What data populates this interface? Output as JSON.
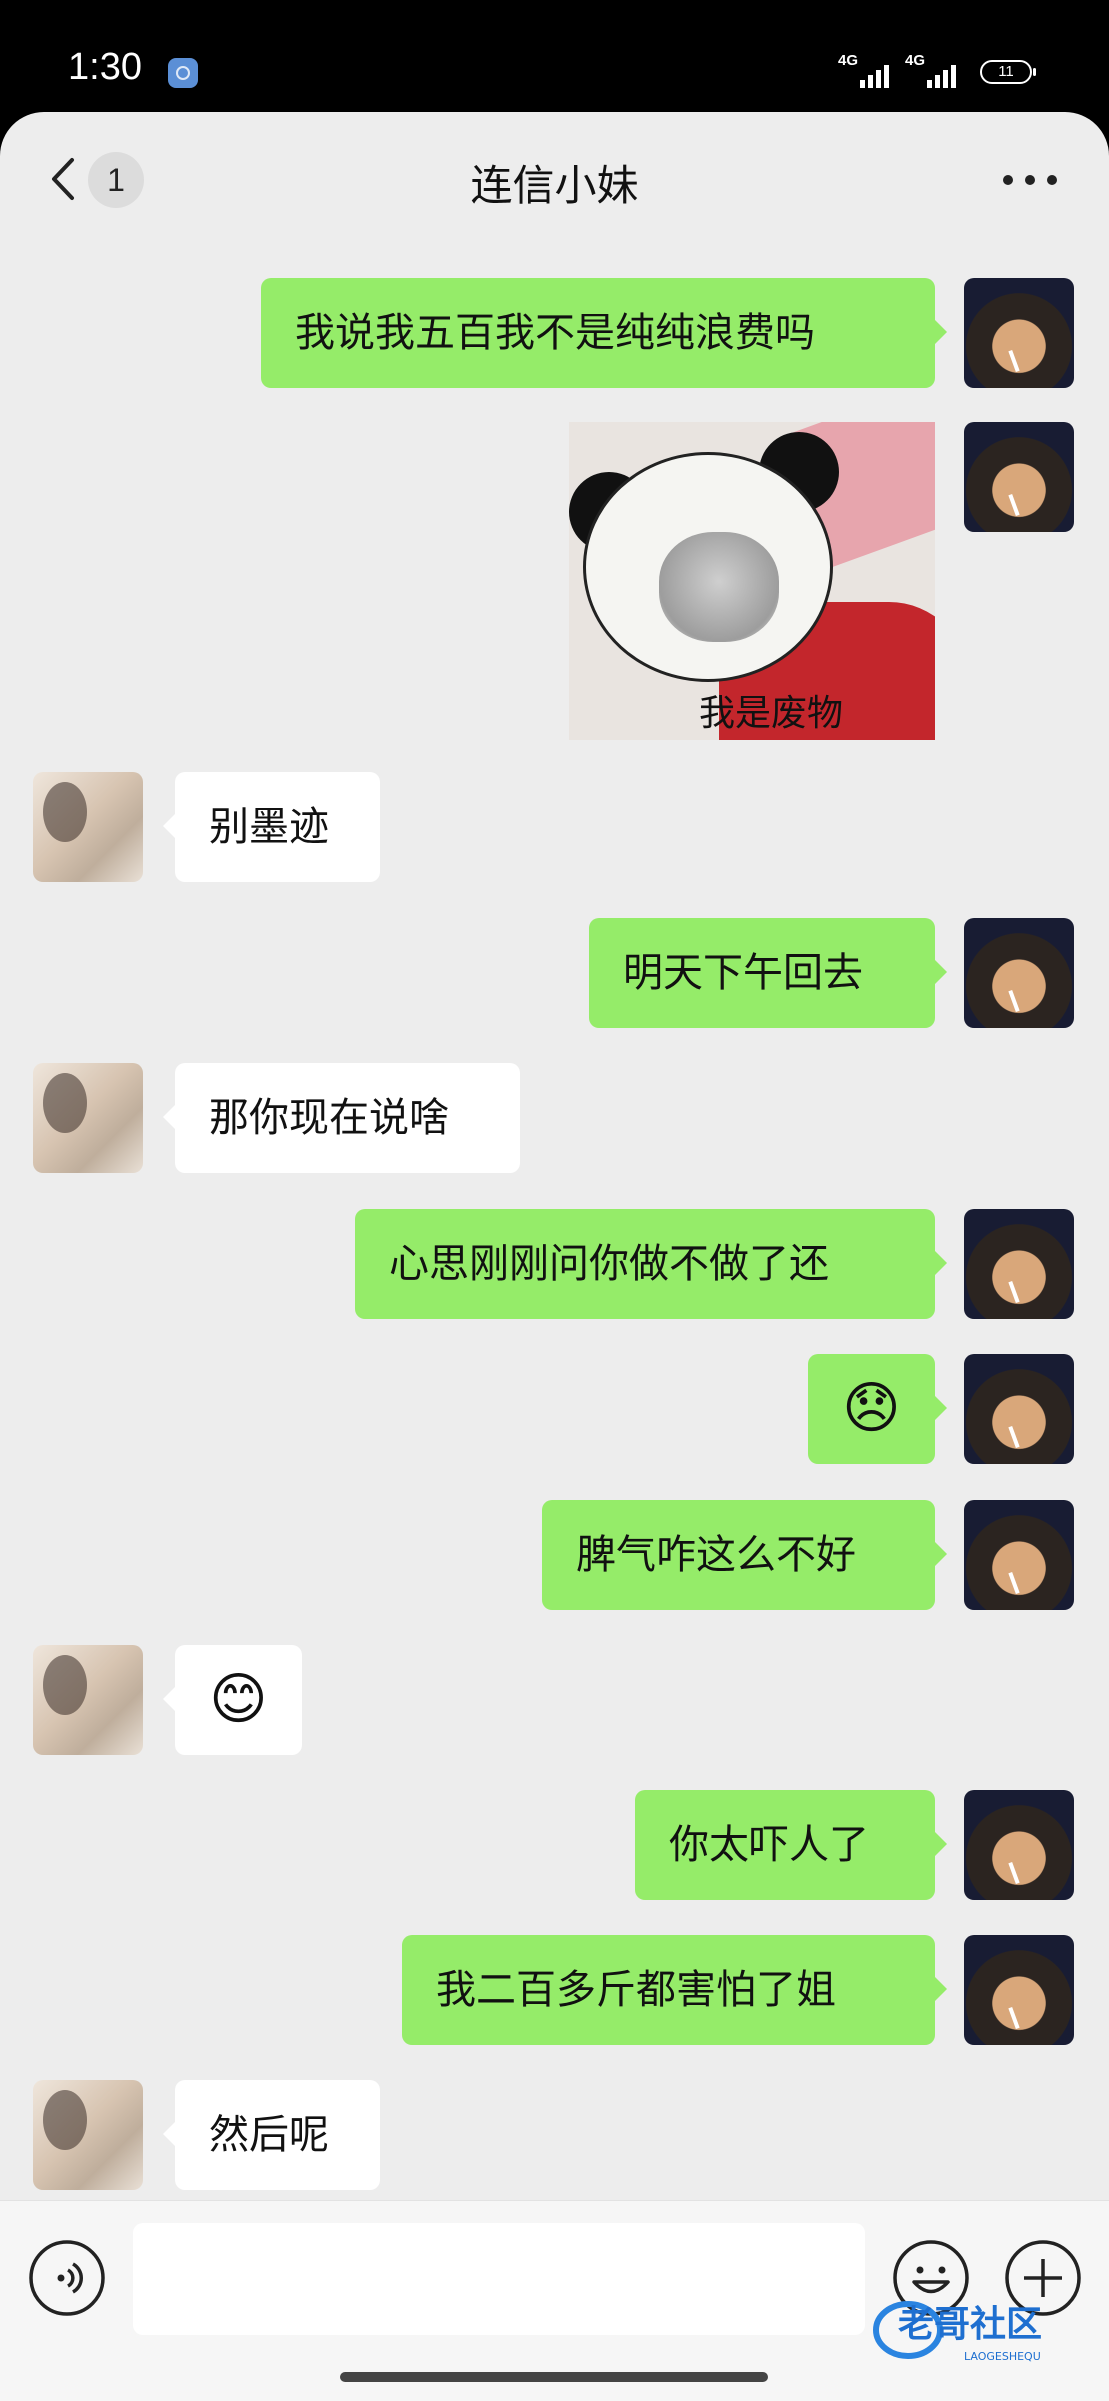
{
  "status_bar": {
    "time": "1:30",
    "signal1": "4G",
    "signal2": "4G",
    "battery": "11"
  },
  "header": {
    "unread_count": "1",
    "title": "连信小妹"
  },
  "messages": [
    {
      "side": "me",
      "text": "我说我五百我不是纯纯浪费吗"
    },
    {
      "side": "me",
      "type": "sticker",
      "caption": "我是废物"
    },
    {
      "side": "her",
      "text": "别墨迹"
    },
    {
      "side": "me",
      "text": "明天下午回去"
    },
    {
      "side": "her",
      "text": "那你现在说啥"
    },
    {
      "side": "me",
      "text": "心思刚刚问你做不做了还"
    },
    {
      "side": "me",
      "text": "😞"
    },
    {
      "side": "me",
      "text": "脾气咋这么不好"
    },
    {
      "side": "her",
      "text": "😊"
    },
    {
      "side": "me",
      "text": "你太吓人了"
    },
    {
      "side": "me",
      "text": "我二百多斤都害怕了姐"
    },
    {
      "side": "her",
      "text": "然后呢"
    }
  ],
  "input": {
    "value": "",
    "placeholder": ""
  },
  "watermark": {
    "text": "老哥社区",
    "subtext": "LAOGESHEQU"
  },
  "colors": {
    "my_bubble": "#95ec69",
    "her_bubble": "#ffffff",
    "chat_bg": "#ededed"
  },
  "icons": {
    "back": "chevron-left-icon",
    "more": "more-dots-icon",
    "voice": "voice-icon",
    "emoji": "emoji-icon",
    "plus": "plus-icon"
  }
}
